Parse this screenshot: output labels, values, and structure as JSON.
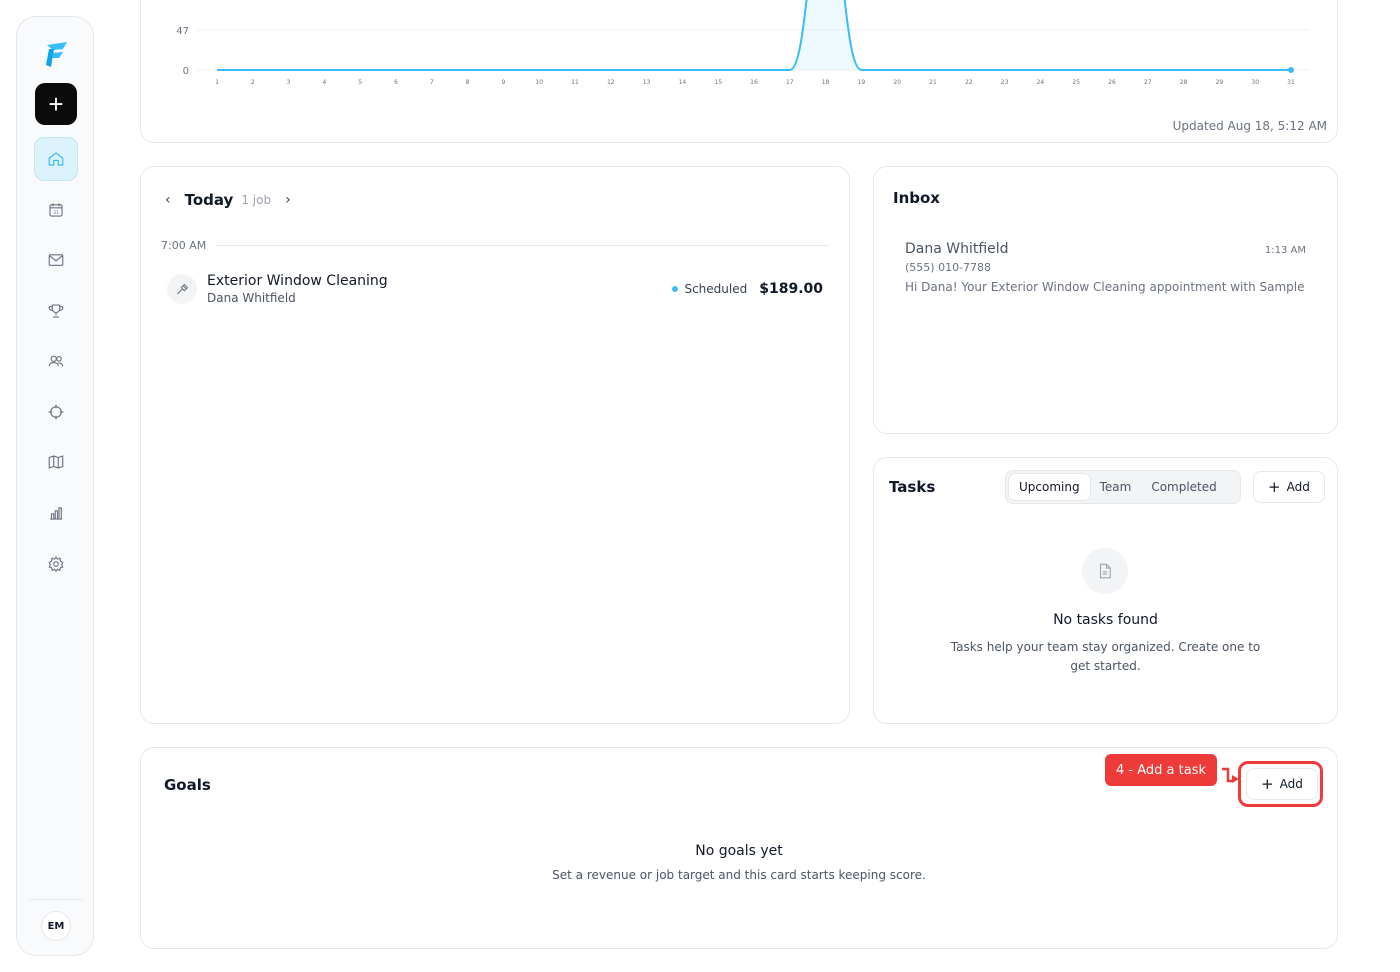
{
  "sidebar": {
    "new_label": "+",
    "avatar_initials": "EM",
    "items": [
      {
        "icon": "home-icon",
        "active": true
      },
      {
        "icon": "calendar-icon",
        "label": "31"
      },
      {
        "icon": "mail-icon"
      },
      {
        "icon": "trophy-icon"
      },
      {
        "icon": "users-icon"
      },
      {
        "icon": "crosshair-icon"
      },
      {
        "icon": "map-icon"
      },
      {
        "icon": "bar-chart-icon"
      },
      {
        "icon": "gear-icon"
      }
    ]
  },
  "chart_data": {
    "type": "line",
    "x": [
      1,
      2,
      3,
      4,
      5,
      6,
      7,
      8,
      9,
      10,
      11,
      12,
      13,
      14,
      15,
      16,
      17,
      18,
      19,
      20,
      21,
      22,
      23,
      24,
      25,
      26,
      27,
      28,
      29,
      30,
      31
    ],
    "series": [
      {
        "values": [
          0,
          0,
          0,
          0,
          0,
          0,
          0,
          0,
          0,
          0,
          0,
          0,
          0,
          0,
          0,
          0,
          0,
          189,
          0,
          0,
          0,
          0,
          0,
          0,
          0,
          0,
          0,
          0,
          0,
          0,
          0
        ]
      }
    ],
    "y_ticks": [
      0,
      47
    ],
    "ylim": [
      0,
      189
    ],
    "grid": true,
    "line_color": "#38bdf8",
    "updated_text": "Updated Aug 18, 5:12 AM"
  },
  "today": {
    "title": "Today",
    "count": "1 job",
    "time_label": "7:00 AM",
    "job": {
      "title": "Exterior Window Cleaning",
      "client": "Dana Whitfield",
      "status": "Scheduled",
      "price": "$189.00"
    }
  },
  "inbox": {
    "title": "Inbox",
    "message": {
      "name": "Dana Whitfield",
      "time": "1:13 AM",
      "phone": "(555) 010-7788",
      "body": "Hi Dana! Your Exterior Window Cleaning appointment with Sample Sh"
    }
  },
  "tasks": {
    "title": "Tasks",
    "tabs": [
      "Upcoming",
      "Team",
      "Completed"
    ],
    "active_tab": "Upcoming",
    "add_label": "Add",
    "empty_title": "No tasks found",
    "empty_sub": "Tasks help your team stay organized. Create one to get started."
  },
  "goals": {
    "title": "Goals",
    "add_label": "Add",
    "callout": "4 - Add a task",
    "empty_title": "No goals yet",
    "empty_sub": "Set a revenue or job target and this card starts keeping score."
  },
  "colors": {
    "accent": "#38bdf8",
    "callout": "#ef3a3a"
  }
}
